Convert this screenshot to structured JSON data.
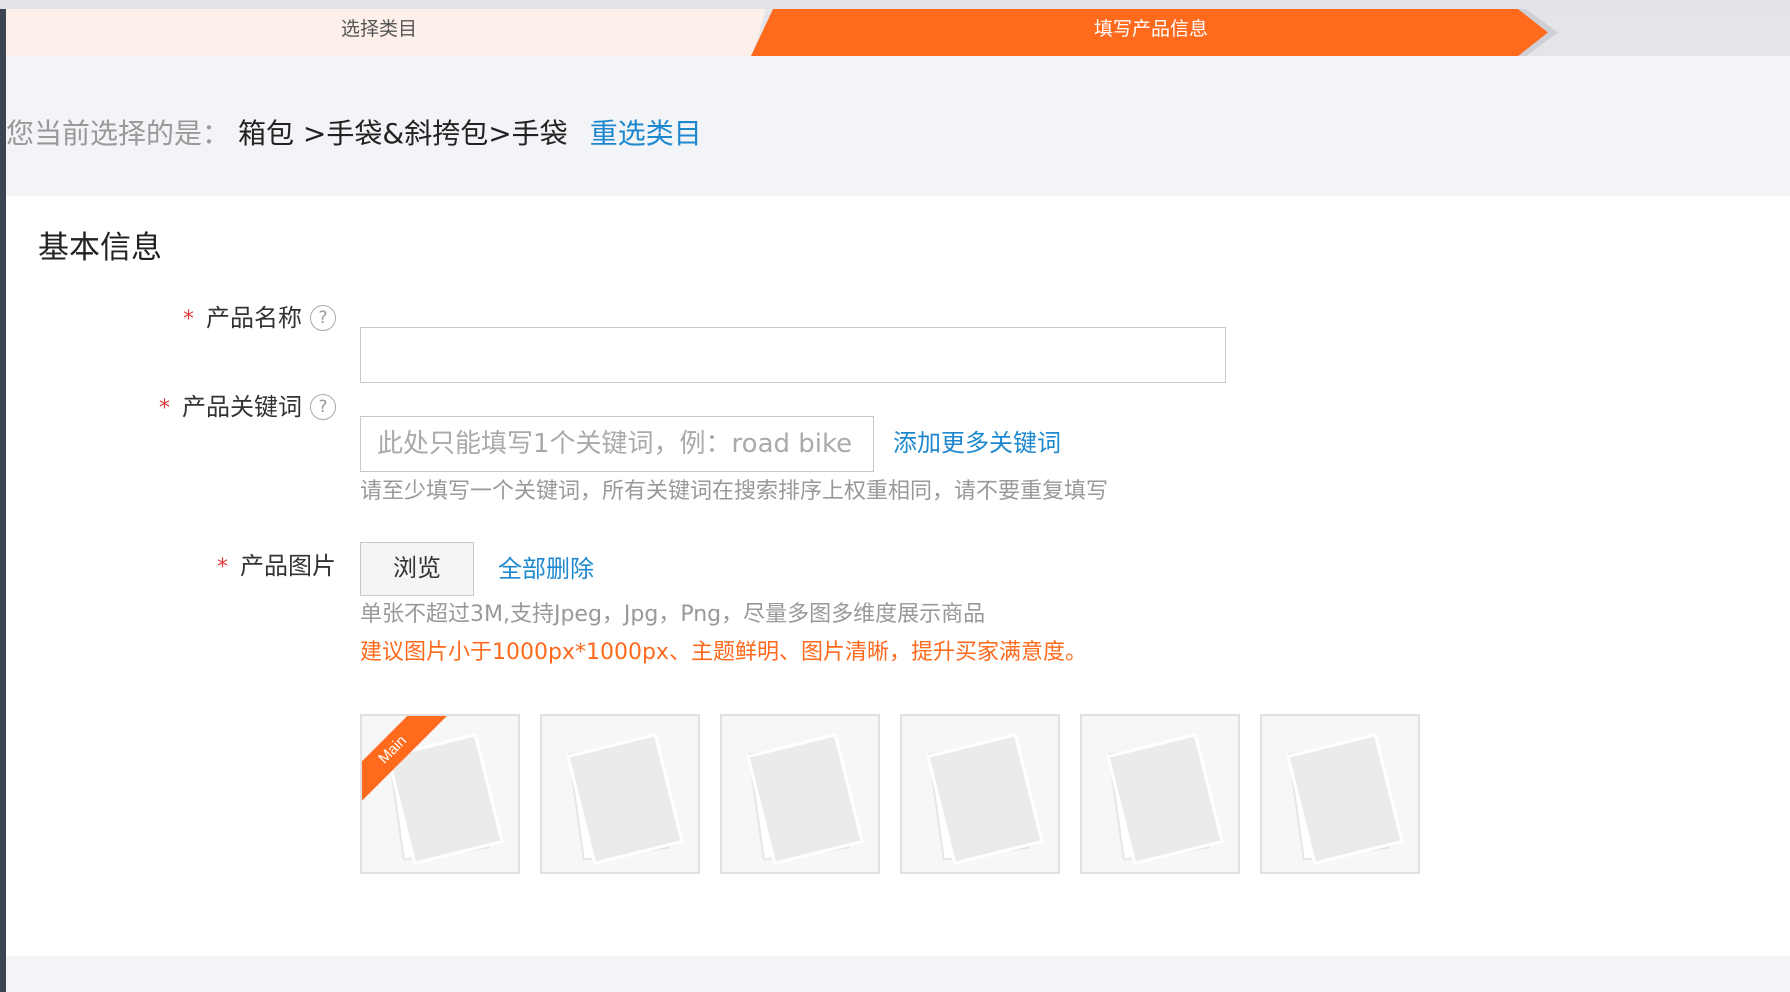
{
  "steps": {
    "step1_label": "选择类目",
    "step2_label": "填写产品信息"
  },
  "selection": {
    "prefix": "您当前选择的是：",
    "path": "箱包 >手袋&斜挎包>手袋",
    "reselect_label": "重选类目"
  },
  "basic_info": {
    "title": "基本信息",
    "product_name": {
      "label": "产品名称",
      "value": "",
      "placeholder": ""
    },
    "keywords": {
      "label": "产品关键词",
      "value": "",
      "placeholder": "此处只能填写1个关键词，例：road bike",
      "add_more_label": "添加更多关键词",
      "hint": "请至少填写一个关键词，所有关键词在搜索排序上权重相同，请不要重复填写"
    },
    "images": {
      "label": "产品图片",
      "browse_label": "浏览",
      "delete_all_label": "全部删除",
      "hint": "单张不超过3M,支持Jpeg，Jpg，Png，尽量多图多维度展示商品",
      "suggestion": "建议图片小于1000px*1000px、主题鲜明、图片清晰，提升买家满意度。",
      "main_badge": "Main",
      "slots": 6
    }
  },
  "colors": {
    "accent_orange": "#ff6a1d",
    "link_blue": "#1e88cf",
    "required_red": "#e4393c"
  },
  "icons": {
    "help": "question-circle-icon",
    "placeholder_image": "image-placeholder-icon"
  }
}
